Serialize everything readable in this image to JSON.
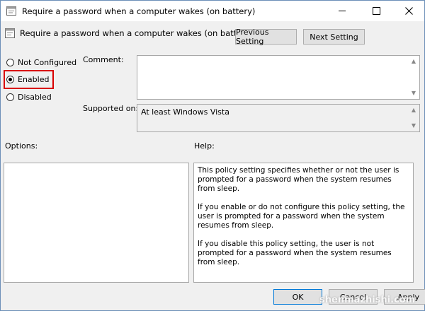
{
  "window": {
    "title": "Require a password when a computer wakes (on battery)",
    "controls": {
      "minimize": "minimize-icon",
      "maximize": "maximize-icon",
      "close": "close-icon"
    }
  },
  "header": {
    "title": "Require a password when a computer wakes (on battery)",
    "previous_label": "Previous Setting",
    "next_label": "Next Setting"
  },
  "state": {
    "options": [
      {
        "label": "Not Configured",
        "checked": false
      },
      {
        "label": "Enabled",
        "checked": true
      },
      {
        "label": "Disabled",
        "checked": false
      }
    ],
    "highlight_color": "#d90000"
  },
  "comment": {
    "label": "Comment:",
    "value": ""
  },
  "supported": {
    "label": "Supported on:",
    "value": "At least Windows Vista"
  },
  "options_pane": {
    "label": "Options:"
  },
  "help_pane": {
    "label": "Help:",
    "paragraphs": [
      "This policy setting specifies whether or not the user is prompted for a password when the system resumes from sleep.",
      "If you enable or do not configure this policy setting, the user is prompted for a password when the system resumes from sleep.",
      "If you disable this policy setting, the user is not prompted for a password when the system resumes from sleep."
    ]
  },
  "footer": {
    "ok_label": "OK",
    "cancel_label": "Cancel",
    "apply_label": "Apply"
  },
  "watermark": "shenmazhishi.com",
  "colors": {
    "accent": "#0078d7",
    "border": "#a8a8a8"
  }
}
